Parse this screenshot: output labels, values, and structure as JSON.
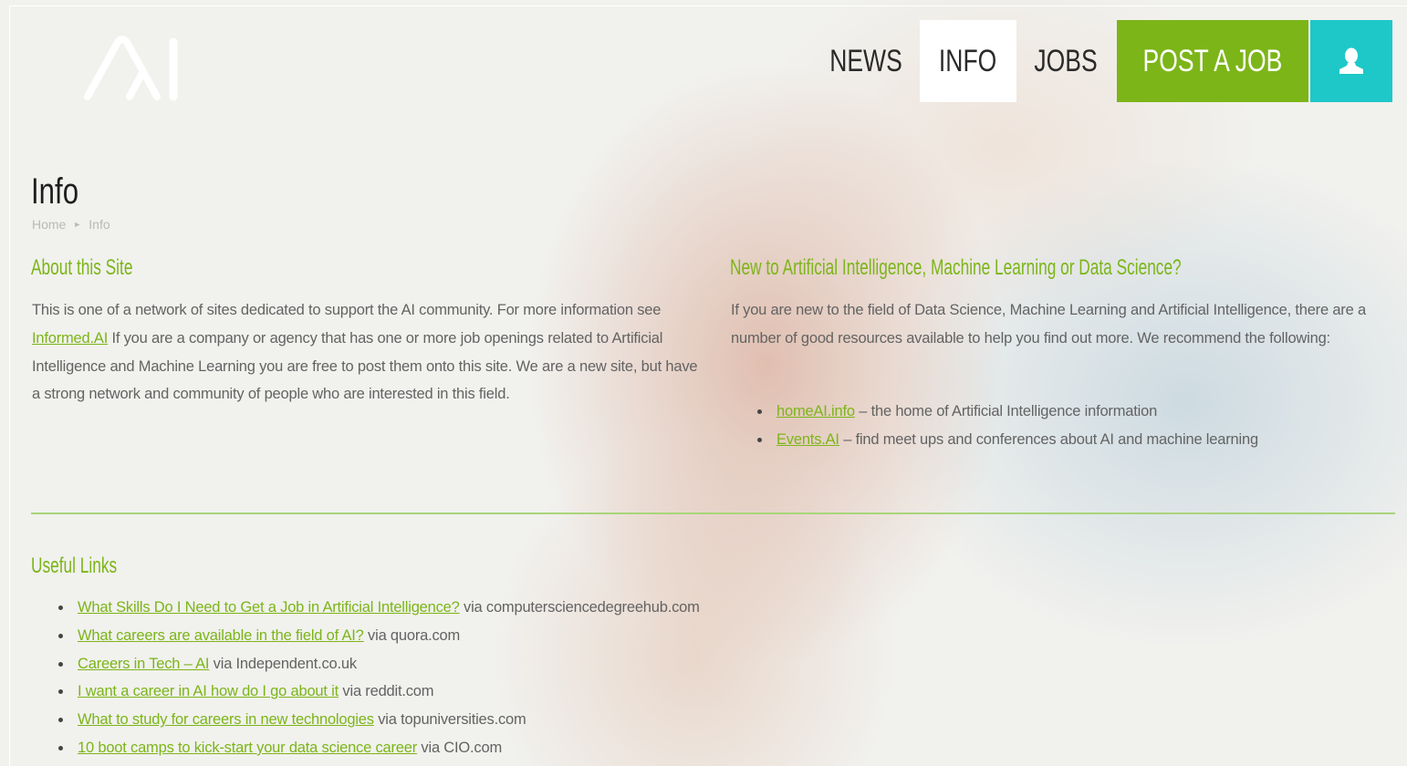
{
  "colors": {
    "accent_green": "#7cb518",
    "accent_teal": "#1ec8c8",
    "text_dark": "#1e1e1e",
    "text_body": "#636363",
    "divider": "#a9d57a"
  },
  "header": {
    "logo_icon": "ai-logo-icon",
    "nav": {
      "news": "NEWS",
      "info": "INFO",
      "jobs": "JOBS",
      "post_job": "POST A JOB",
      "user_icon": "user-icon"
    }
  },
  "page": {
    "title": "Info",
    "breadcrumb": {
      "home": "Home",
      "separator": "►",
      "current": "Info"
    }
  },
  "about": {
    "heading": "About this Site",
    "text_1": "This is one of a network of sites dedicated to support the AI community. For more information see",
    "link": "Informed.AI",
    "text_2": "If you are a company or agency that has one or more job openings related to Artificial Intelligence and Machine Learning you are free to post them onto this site. We are a new site, but have a strong network and community of people who are interested in this field."
  },
  "new_to_ai": {
    "heading": "New to Artificial Intelligence, Machine Learning or Data Science?",
    "text": "If you are new to the field of Data Science, Machine Learning and Artificial Intelligence, there are a number of good resources available to help you find out more. We recommend the following:",
    "items": [
      {
        "link": "homeAI.info",
        "text": "– the home of Artificial Intelligence information"
      },
      {
        "link": "Events.AI",
        "text": "– find meet ups and conferences about AI and machine learning"
      }
    ]
  },
  "useful_links": {
    "heading": "Useful Links",
    "items": [
      {
        "link": "What Skills Do I Need to Get a Job in Artificial Intelligence?",
        "via": "via computersciencedegreehub.com"
      },
      {
        "link": "What careers are available in the field of AI?",
        "via": "via quora.com"
      },
      {
        "link": "Careers in Tech – AI",
        "via": "via Independent.co.uk"
      },
      {
        "link": "I want a career in AI how do I go about it",
        "via": "via reddit.com"
      },
      {
        "link": "What to study for careers in new technologies",
        "via": "via topuniversities.com"
      },
      {
        "link": "10 boot camps to kick-start your data science career",
        "via": "via CIO.com"
      }
    ]
  }
}
